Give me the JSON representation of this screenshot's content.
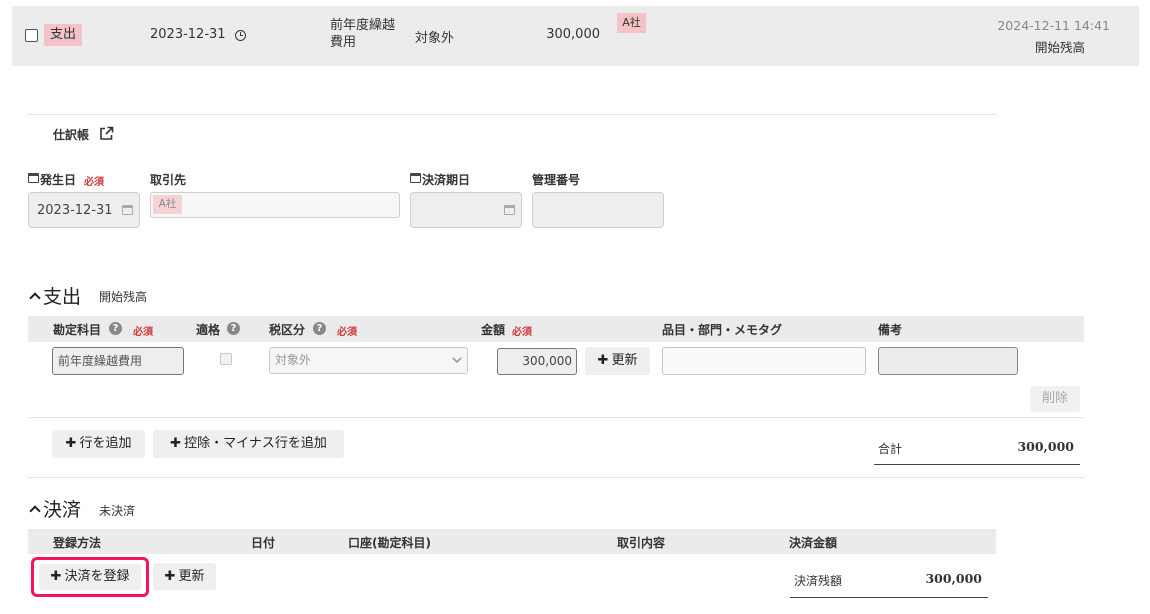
{
  "entry_row": {
    "type_label": "支出",
    "date": "2023-12-31",
    "account": "前年度繰越費用",
    "tax": "対象外",
    "amount": "300,000",
    "partner_tag": "A社",
    "timestamp": "2024-12-11 14:41",
    "note": "開始残高"
  },
  "journal": {
    "label": "仕訳帳"
  },
  "form": {
    "occurrence_date_label": "発生日",
    "required": "必須",
    "occurrence_date_value": "2023-12-31",
    "partner_label": "取引先",
    "partner_tag": "A社",
    "due_date_label": "決済期日",
    "management_no_label": "管理番号"
  },
  "expense_section": {
    "title": "支出",
    "subtitle": "開始残高",
    "headers": {
      "account": "勘定科目",
      "eligible": "適格",
      "tax": "税区分",
      "amount": "金額",
      "items": "品目・部門・メモタグ",
      "remarks": "備考"
    },
    "row": {
      "account": "前年度繰越費用",
      "tax": "対象外",
      "amount": "300,000",
      "update_label": "更新",
      "delete_label": "削除"
    },
    "add_row_label": "行を追加",
    "add_deduction_label": "控除・マイナス行を追加",
    "total_label": "合計",
    "total_value": "300,000"
  },
  "settlement_section": {
    "title": "決済",
    "subtitle": "未決済",
    "headers": {
      "method": "登録方法",
      "date": "日付",
      "account": "口座(勘定科目)",
      "content": "取引内容",
      "amount": "決済金額"
    },
    "register_label": "決済を登録",
    "update_label": "更新",
    "balance_label": "決済残額",
    "balance_value": "300,000"
  }
}
